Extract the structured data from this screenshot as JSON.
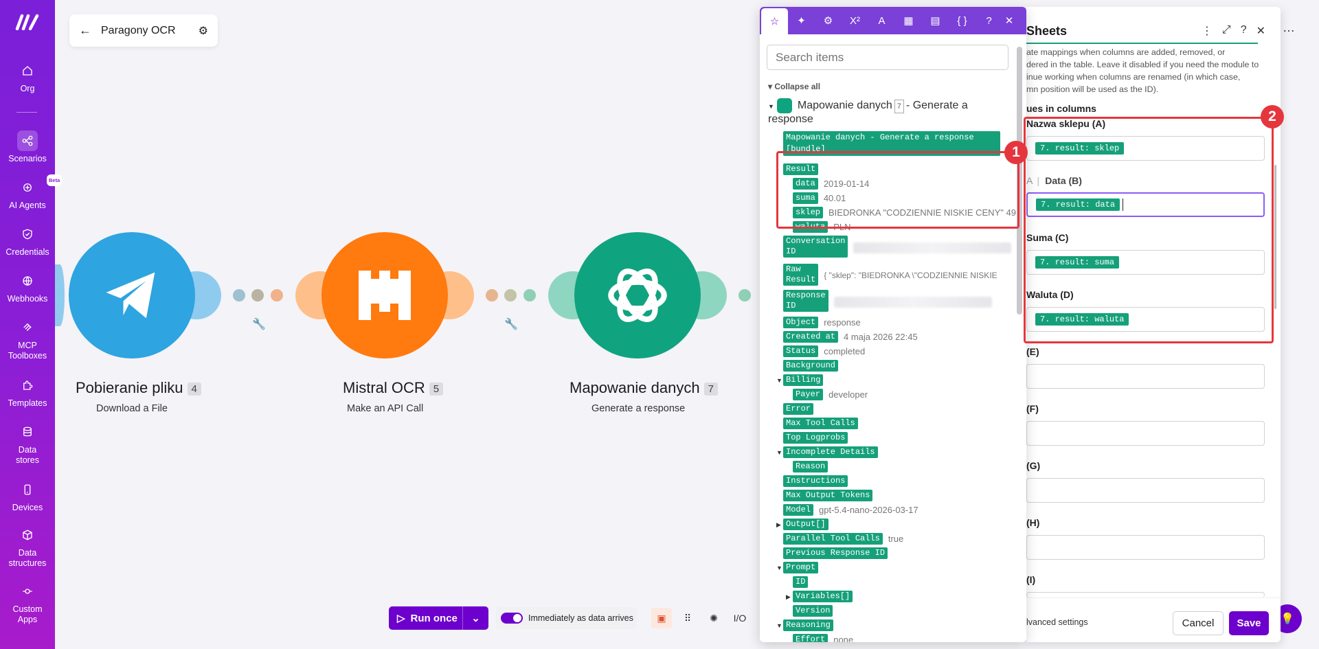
{
  "sidebar": {
    "items": [
      {
        "label": "Org",
        "icon": "home-icon"
      },
      {
        "label": "Scenarios",
        "icon": "scenarios-icon"
      },
      {
        "label": "AI Agents",
        "icon": "ai-agents-icon",
        "badge": "Beta"
      },
      {
        "label": "Credentials",
        "icon": "shield-icon"
      },
      {
        "label": "Webhooks",
        "icon": "globe-icon"
      },
      {
        "label": "MCP Toolboxes",
        "icon": "mcp-icon"
      },
      {
        "label": "Templates",
        "icon": "puzzle-icon"
      },
      {
        "label": "Data stores",
        "icon": "database-icon"
      },
      {
        "label": "Devices",
        "icon": "phone-icon"
      },
      {
        "label": "Data structures",
        "icon": "cube-icon"
      },
      {
        "label": "Custom Apps",
        "icon": "custom-apps-icon"
      }
    ]
  },
  "scenario": {
    "title": "Paragony OCR"
  },
  "nodes": [
    {
      "name": "Pobieranie pliku",
      "num": "4",
      "sub": "Download a File",
      "color": "#2ea4e1"
    },
    {
      "name": "Mistral OCR",
      "num": "5",
      "sub": "Make an API Call",
      "color": "#ff7a0f"
    },
    {
      "name": "Mapowanie danych",
      "num": "7",
      "sub": "Generate a response",
      "color": "#10a37f"
    }
  ],
  "bottombar": {
    "run_label": "Run once",
    "toggle_label": "Immediately as data arrives"
  },
  "picker": {
    "search_placeholder": "Search items",
    "collapse_all": "Collapse all",
    "module_title": "Mapowanie danych",
    "module_num": "7",
    "module_suffix": "- Generate a response",
    "bundle_label": "Mapowanie danych - Generate a response [bundle]",
    "rows": [
      {
        "tag": "Result",
        "value": ""
      },
      {
        "tag": "data",
        "value": "2019-01-14"
      },
      {
        "tag": "suma",
        "value": "40.01"
      },
      {
        "tag": "sklep",
        "value": "BIEDRONKA \"CODZIENNIE NISKIE CENY\" 49"
      },
      {
        "tag": "waluta",
        "value": "PLN"
      },
      {
        "tag": "Object",
        "value": "response"
      },
      {
        "tag": "Created at",
        "value": "4 maja 2026 22:45"
      },
      {
        "tag": "Status",
        "value": "completed"
      },
      {
        "tag": "Background",
        "value": ""
      },
      {
        "tag": "Billing",
        "value": ""
      },
      {
        "tag": "Payer",
        "value": "developer"
      },
      {
        "tag": "Error",
        "value": ""
      },
      {
        "tag": "Max Tool Calls",
        "value": ""
      },
      {
        "tag": "Top Logprobs",
        "value": ""
      },
      {
        "tag": "Incomplete Details",
        "value": ""
      },
      {
        "tag": "Reason",
        "value": ""
      },
      {
        "tag": "Instructions",
        "value": ""
      },
      {
        "tag": "Max Output Tokens",
        "value": ""
      },
      {
        "tag": "Model",
        "value": "gpt-5.4-nano-2026-03-17"
      },
      {
        "tag": "Output[]",
        "value": ""
      },
      {
        "tag": "Parallel Tool Calls",
        "value": "true"
      },
      {
        "tag": "Previous Response ID",
        "value": ""
      },
      {
        "tag": "Prompt",
        "value": ""
      },
      {
        "tag": "ID",
        "value": ""
      },
      {
        "tag": "Variables[]",
        "value": ""
      },
      {
        "tag": "Version",
        "value": ""
      },
      {
        "tag": "Reasoning",
        "value": ""
      },
      {
        "tag": "Effort",
        "value": "none"
      }
    ],
    "conv_tag_1": "Conversation",
    "conv_tag_2": "ID",
    "raw_tag_1": "Raw",
    "raw_tag_2": "Result",
    "raw_value": "{ \"sklep\": \"BIEDRONKA \\\"CODZIENNIE NISKIE",
    "resp_tag_1": "Response",
    "resp_tag_2": "ID"
  },
  "sheets": {
    "title": "Sheets",
    "description": "...te mappings when columns are added, removed, or ordered in the table. Leave it disabled if you need the module to continue working when columns are renamed (in which case, column position will be used as the ID).",
    "desc_line1": "ate mappings when columns are added, removed, or",
    "desc_line2": "dered in the table. Leave it disabled if you need the module to",
    "desc_line3": "inue working when columns are renamed (in which case,",
    "desc_line4": "mn position will be used as the ID).",
    "section": "ues in columns",
    "fields": [
      {
        "label": "Nazwa sklepu (A)",
        "value": "7. result: sklep"
      },
      {
        "label": "Data (B)",
        "value": "7. result: data"
      },
      {
        "label": "Suma (C)",
        "value": "7. result: suma"
      },
      {
        "label": "Waluta (D)",
        "value": "7. result: waluta"
      },
      {
        "label": "(E)",
        "value": ""
      },
      {
        "label": "(F)",
        "value": ""
      },
      {
        "label": "(G)",
        "value": ""
      },
      {
        "label": "(H)",
        "value": ""
      },
      {
        "label": "(I)",
        "value": ""
      }
    ],
    "advanced": "lvanced settings",
    "cancel": "Cancel",
    "save": "Save"
  },
  "annotations": {
    "one": "1",
    "two": "2"
  },
  "colors": {
    "accent": "#6d00cc",
    "tag": "#16a07a",
    "highlight": "#e5363e"
  }
}
